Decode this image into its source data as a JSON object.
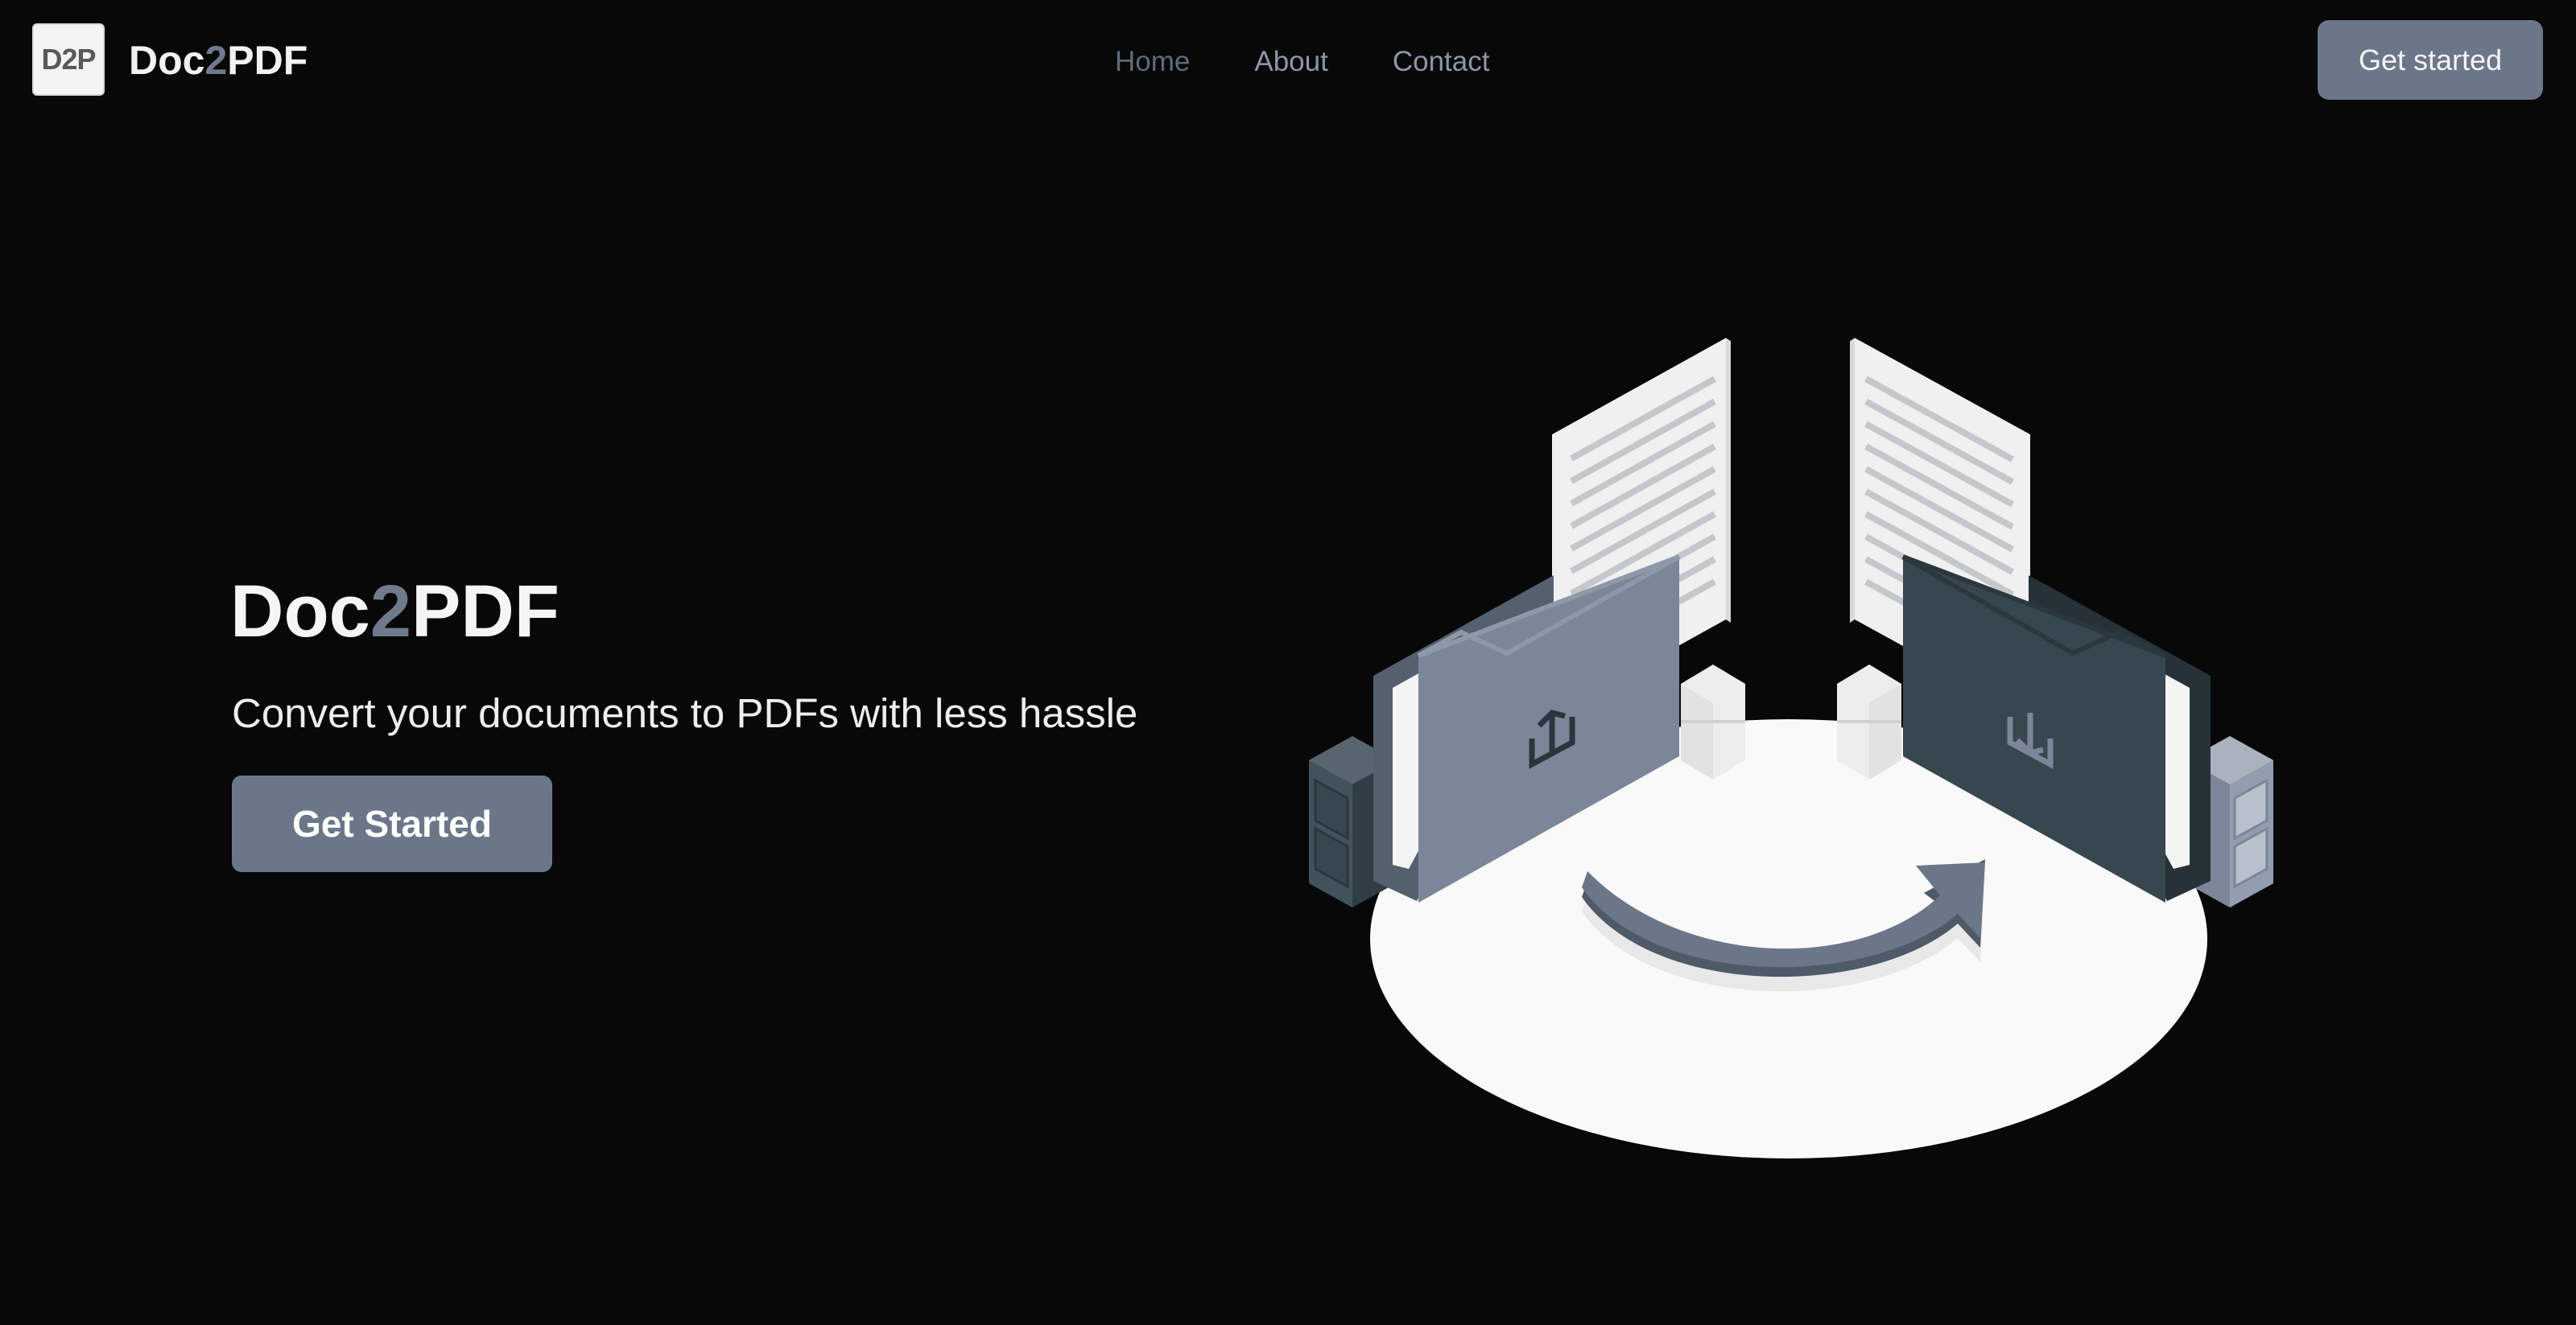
{
  "header": {
    "logo_text": "D2P",
    "brand_prefix": "Doc",
    "brand_accent": "2",
    "brand_suffix": "PDF",
    "nav": [
      {
        "label": "Home"
      },
      {
        "label": "About"
      },
      {
        "label": "Contact"
      }
    ],
    "cta_label": "Get started"
  },
  "hero": {
    "title_prefix": "Doc",
    "title_accent": "2",
    "title_suffix": "PDF",
    "subtitle": "Convert your documents to PDFs with less hassle",
    "cta_label": "Get Started"
  },
  "illustration": {
    "icons": [
      "upload-icon",
      "download-icon",
      "document-icon",
      "folder-icon",
      "convert-arrow-icon",
      "file-cabinet-icon"
    ]
  },
  "colors": {
    "background": "#080808",
    "accent": "#6b7789",
    "text": "#f5f5f5",
    "nav_active": "#5e6a7c",
    "nav_inactive": "#8c96a6",
    "folder_light": "#7b8798",
    "folder_dark": "#37474f"
  }
}
